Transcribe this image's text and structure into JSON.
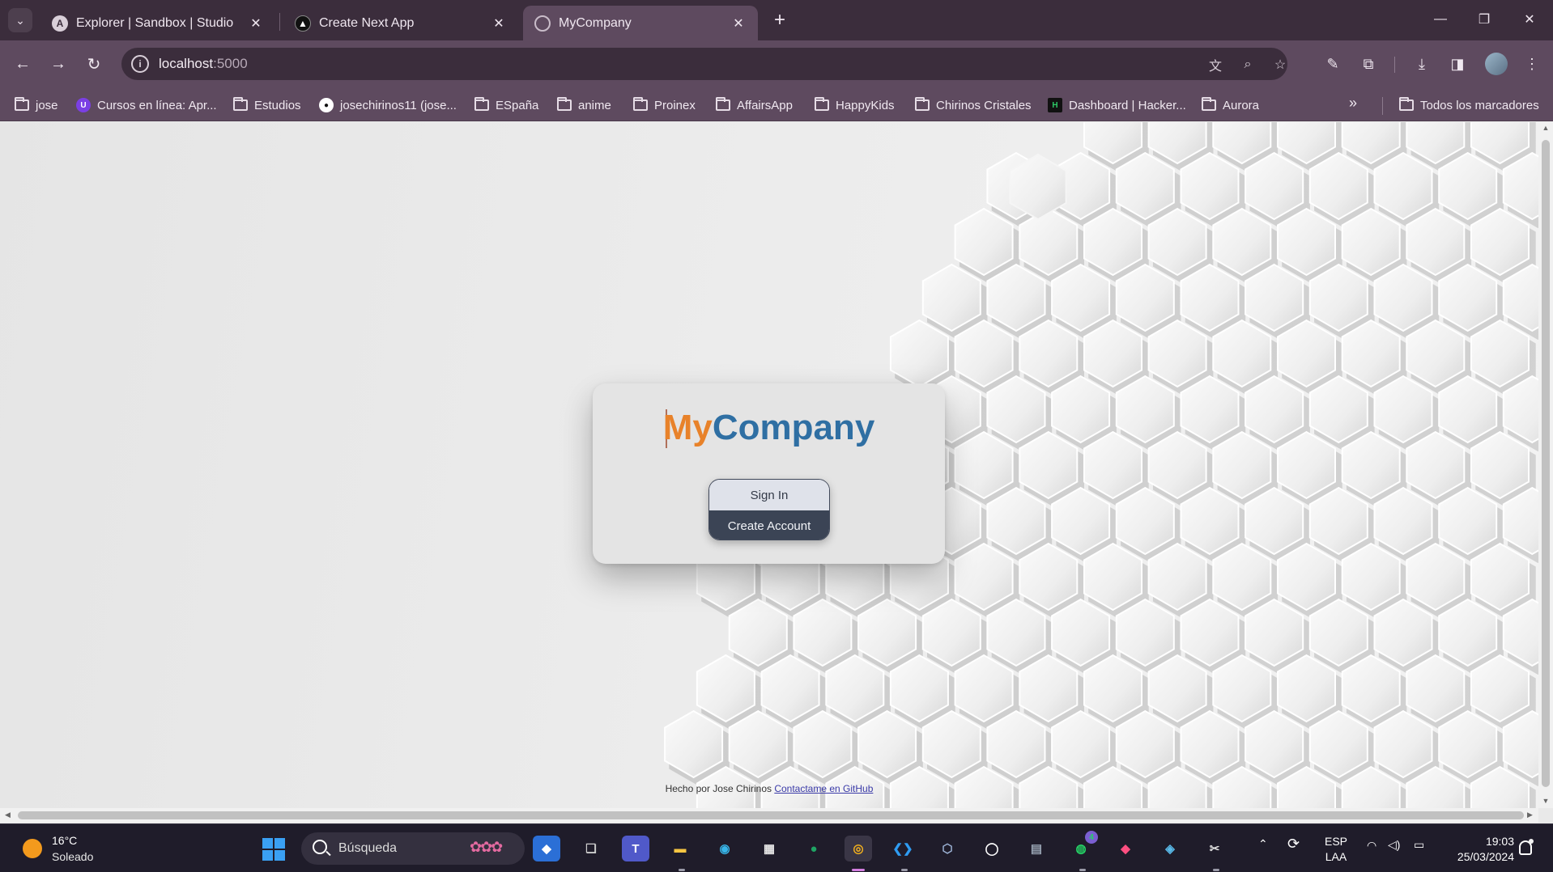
{
  "browser": {
    "tabs": [
      {
        "title": "Explorer | Sandbox | Studio",
        "icon": "ai-studio-icon",
        "active": false
      },
      {
        "title": "Create Next App",
        "icon": "triangle-icon",
        "active": false
      },
      {
        "title": "MyCompany",
        "icon": "globe-icon",
        "active": true
      }
    ],
    "url_host": "localhost",
    "url_port": ":5000",
    "bookmarks": [
      {
        "label": "jose",
        "type": "folder"
      },
      {
        "label": "Cursos en línea: Apr...",
        "type": "site",
        "color": "#7b3fe4"
      },
      {
        "label": "Estudios",
        "type": "folder"
      },
      {
        "label": "josechirinos11 (jose...",
        "type": "site",
        "color": "#ffffff"
      },
      {
        "label": "ESpaña",
        "type": "folder"
      },
      {
        "label": "anime",
        "type": "folder"
      },
      {
        "label": "Proinex",
        "type": "folder"
      },
      {
        "label": "AffairsApp",
        "type": "folder"
      },
      {
        "label": "HappyKids",
        "type": "folder"
      },
      {
        "label": "Chirinos Cristales",
        "type": "folder"
      },
      {
        "label": "Dashboard | Hacker...",
        "type": "site",
        "color": "#111111"
      },
      {
        "label": "Aurora",
        "type": "folder"
      }
    ],
    "all_bookmarks": "Todos los marcadores"
  },
  "page": {
    "brand_my": "My",
    "brand_company": "Company",
    "sign_in": "Sign In",
    "create_account": "Create Account",
    "footer_text": "Hecho por Jose Chirinos ",
    "footer_link": "Contactame en GitHub"
  },
  "colors": {
    "brand_orange": "#e8822a",
    "brand_blue": "#2f6fa3",
    "button_dark": "#3b4455",
    "chrome_purple": "#5e4a5f"
  },
  "taskbar": {
    "temperature": "16°C",
    "weather": "Soleado",
    "search_placeholder": "Búsqueda",
    "whatsapp_badge": "4",
    "language": "ESP",
    "layout": "LAA",
    "time": "19:03",
    "date": "25/03/2024"
  }
}
